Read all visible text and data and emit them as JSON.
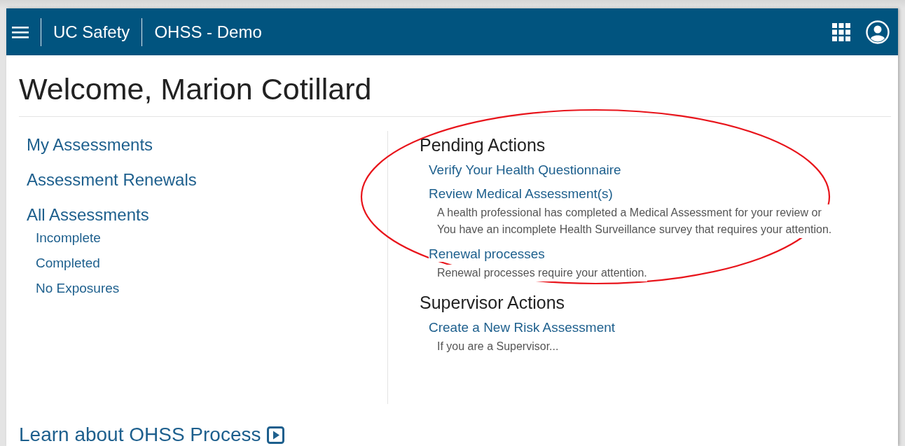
{
  "header": {
    "app_name": "UC Safety",
    "module": "OHSS - Demo"
  },
  "welcome": "Welcome, Marion Cotillard",
  "nav": [
    {
      "label": "My Assessments"
    },
    {
      "label": "Assessment Renewals"
    },
    {
      "label": "All Assessments",
      "children": [
        {
          "label": "Incomplete"
        },
        {
          "label": "Completed"
        },
        {
          "label": "No Exposures"
        }
      ]
    }
  ],
  "sections": [
    {
      "title": "Pending Actions",
      "actions": [
        {
          "label": "Verify Your Health Questionnaire"
        },
        {
          "label": "Review Medical Assessment(s)",
          "description": "A health professional has completed a Medical Assessment for your review or You have an incomplete Health Surveillance survey that requires your attention."
        },
        {
          "label": "Renewal processes",
          "description": "Renewal processes require your attention."
        }
      ]
    },
    {
      "title": "Supervisor Actions",
      "actions": [
        {
          "label": "Create a New Risk Assessment",
          "description": "If you are a Supervisor..."
        }
      ]
    }
  ],
  "learn_link": "Learn about OHSS Process"
}
